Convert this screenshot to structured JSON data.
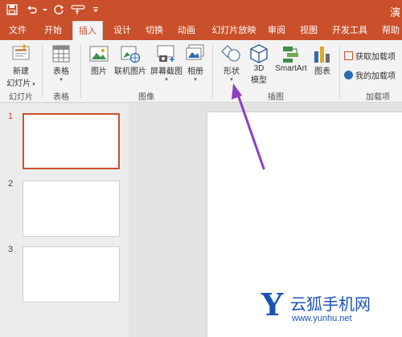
{
  "title_bar": {
    "title_fragment": "演",
    "qat_icons": [
      "save-icon",
      "undo-icon",
      "redo-icon",
      "touch-mode-icon",
      "customize-qat-icon"
    ]
  },
  "tabs": [
    {
      "label": "文件"
    },
    {
      "label": "开始"
    },
    {
      "label": "插入",
      "active": true
    },
    {
      "label": "设计"
    },
    {
      "label": "切换"
    },
    {
      "label": "动画"
    },
    {
      "label": "幻灯片放映"
    },
    {
      "label": "审阅"
    },
    {
      "label": "视图"
    },
    {
      "label": "开发工具"
    },
    {
      "label": "帮助"
    }
  ],
  "ribbon": {
    "slides_group": {
      "new_slide_label_1": "新建",
      "new_slide_label_2": "幻灯片",
      "group_label": "幻灯片"
    },
    "tables_group": {
      "table_label": "表格",
      "group_label": "表格"
    },
    "images_group": {
      "picture_label": "图片",
      "online_picture_label": "联机图片",
      "screenshot_label": "屏幕截图",
      "album_label": "相册",
      "group_label": "图像"
    },
    "illustrations_group": {
      "shapes_label": "形状",
      "model3d_label_1": "3D",
      "model3d_label_2": "模型",
      "smartart_label": "SmartArt",
      "chart_label": "图表",
      "group_label": "插图"
    },
    "addins_group": {
      "get_addins_label": "获取加载项",
      "my_addins_label": "我的加载项",
      "group_label": "加载项"
    }
  },
  "slides": [
    {
      "number": "1",
      "active": true
    },
    {
      "number": "2"
    },
    {
      "number": "3"
    }
  ],
  "watermark": {
    "letter": "Y",
    "text": "云狐手机网",
    "url": "www.yunhu.net"
  },
  "colors": {
    "accent": "#c9502a",
    "annotation_arrow": "#8a3fc4",
    "watermark": "#1b53b4"
  }
}
